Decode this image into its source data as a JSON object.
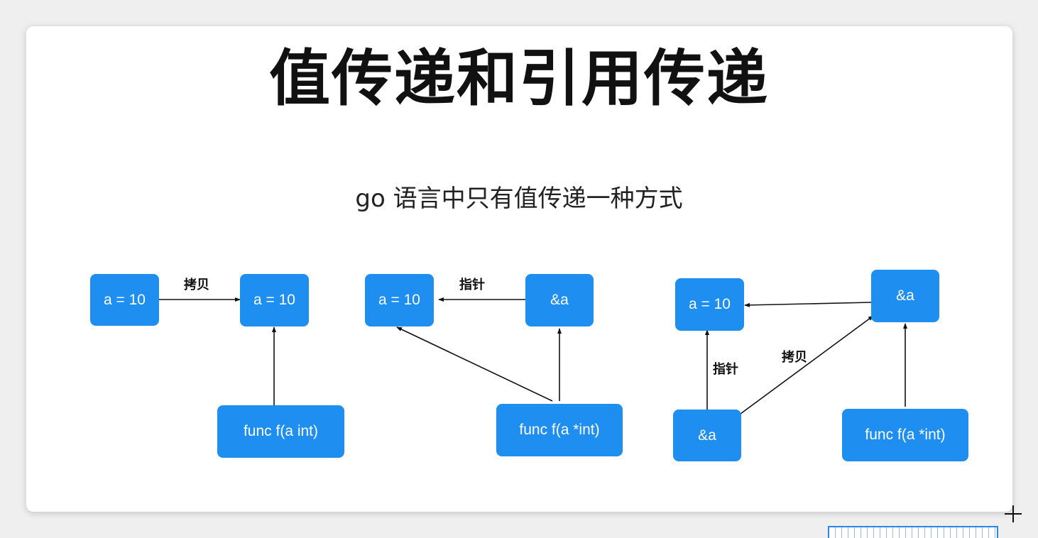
{
  "slide": {
    "title": "值传递和引用传递",
    "subtitle": "go 语言中只有值传递一种方式"
  },
  "diagram1": {
    "left_node": "a = 10",
    "right_node": "a = 10",
    "func_node": "func f(a int)",
    "edge_label": "拷贝"
  },
  "diagram2": {
    "value_node": "a = 10",
    "pointer_node": "&a",
    "func_node": "func f(a *int)",
    "edge_label": "指针"
  },
  "diagram3": {
    "value_node": "a = 10",
    "pointer_node_top": "&a",
    "pointer_node_bottom": "&a",
    "func_node": "func f(a *int)",
    "edge_label_pointer": "指针",
    "edge_label_copy": "拷贝"
  },
  "colors": {
    "node_fill": "#1f8ef1",
    "node_text": "#ffffff",
    "arrow": "#111111"
  }
}
